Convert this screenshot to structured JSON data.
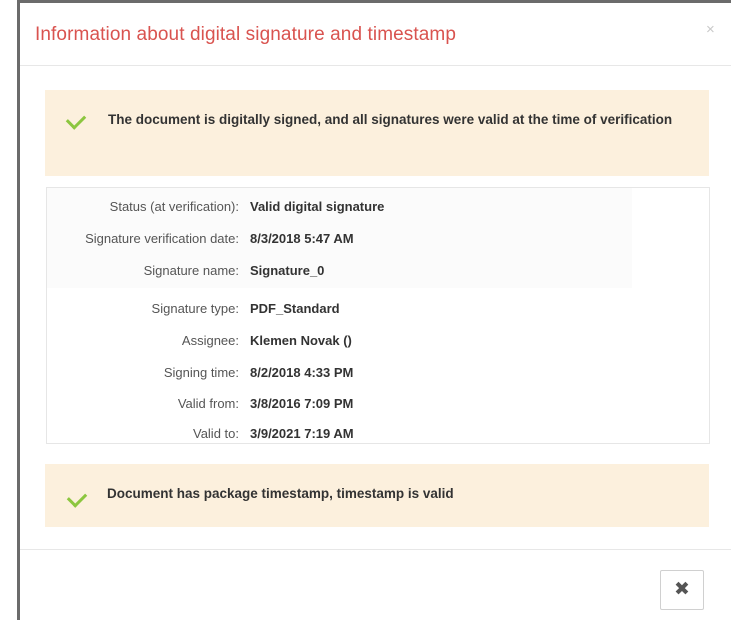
{
  "dialog": {
    "title": "Information about digital signature and timestamp",
    "header_close_glyph": "×",
    "footer_close_glyph": "✖"
  },
  "signature_alert": {
    "icon": "check-icon",
    "text": "The document is digitally signed, and all signatures were valid at the time of verification"
  },
  "details": [
    {
      "label": "Status (at verification):",
      "value": "Valid digital signature"
    },
    {
      "label": "Signature verification date:",
      "value": "8/3/2018 5:47 AM"
    },
    {
      "label": "Signature name:",
      "value": "Signature_0"
    },
    {
      "label": "Signature type:",
      "value": "PDF_Standard"
    },
    {
      "label": "Assignee:",
      "value": "Klemen Novak ()"
    },
    {
      "label": "Signing time:",
      "value": "8/2/2018 4:33 PM"
    },
    {
      "label": "Valid from:",
      "value": "3/8/2016 7:09 PM"
    },
    {
      "label": "Valid to:",
      "value": "3/9/2021 7:19 AM"
    }
  ],
  "timestamp_alert": {
    "icon": "check-icon",
    "text": "Document has package timestamp, timestamp is valid"
  },
  "colors": {
    "title": "#d9534f",
    "alert_background": "#fcf0dd",
    "check": "#8cc63f"
  }
}
